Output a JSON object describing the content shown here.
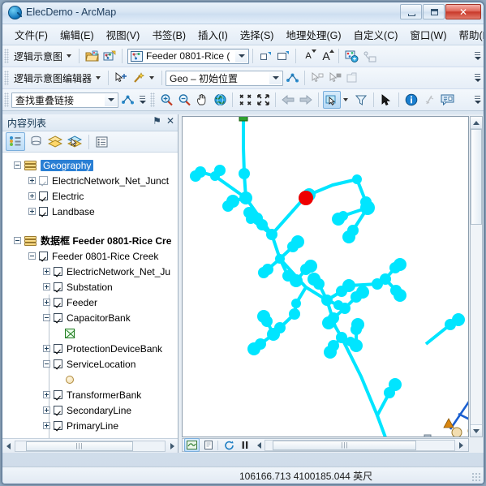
{
  "window": {
    "title": "ElecDemo - ArcMap",
    "app_icon": "arcmap-globe-icon",
    "buttons": {
      "minimize": "minimize-icon",
      "maximize": "maximize-icon",
      "close": "close-icon",
      "close_glyph": "✕"
    }
  },
  "menu": {
    "items": [
      {
        "label": "文件(F)"
      },
      {
        "label": "编辑(E)"
      },
      {
        "label": "视图(V)"
      },
      {
        "label": "书签(B)"
      },
      {
        "label": "插入(I)"
      },
      {
        "label": "选择(S)"
      },
      {
        "label": "地理处理(G)"
      },
      {
        "label": "自定义(C)"
      },
      {
        "label": "窗口(W)"
      },
      {
        "label": "帮助(H)"
      }
    ]
  },
  "toolbar_schematic": {
    "menu_label": "逻辑示意图",
    "open_diagram_icon": "open-folder-icon",
    "save_diagram_icon": "save-diagram-icon",
    "diagram_combo": {
      "value": "Feeder 0801-Rice (",
      "icon": "diagram-icon"
    },
    "buttons": [
      {
        "name": "shrink-diagram-icon"
      },
      {
        "name": "expand-diagram-icon"
      },
      {
        "name": "decrease-font-icon",
        "glyph": "A"
      },
      {
        "name": "increase-font-icon",
        "glyph": "A"
      },
      {
        "name": "diagram-properties-icon"
      },
      {
        "name": "diagram-list-icon"
      }
    ]
  },
  "toolbar_editor": {
    "menu_label": "逻辑示意图编辑器",
    "move_tool_icon": "move-node-icon",
    "layout_tool_icon": "layout-wand-icon",
    "layout_combo": {
      "value": "Geo – 初始位置"
    },
    "apply_icon": "apply-layout-icon",
    "select_node_icon": "select-node-icon",
    "select_link_icon": "select-link-icon",
    "properties_icon": "editor-properties-icon"
  },
  "toolbar_tools": {
    "task_combo": {
      "value": "查找重叠链接"
    },
    "run_icon": "run-trace-icon",
    "map_tools": [
      {
        "name": "zoom-in-icon"
      },
      {
        "name": "zoom-out-icon"
      },
      {
        "name": "pan-icon"
      },
      {
        "name": "full-extent-icon"
      },
      {
        "name": "fixed-zoom-in-icon"
      },
      {
        "name": "fixed-zoom-out-icon"
      },
      {
        "name": "previous-extent-icon"
      },
      {
        "name": "next-extent-icon"
      },
      {
        "name": "select-features-icon",
        "pressed": true
      },
      {
        "name": "select-dropdown-icon"
      },
      {
        "name": "clear-selection-icon"
      },
      {
        "name": "select-elements-icon"
      },
      {
        "name": "identify-icon"
      },
      {
        "name": "hyperlink-icon"
      },
      {
        "name": "html-popup-icon"
      }
    ]
  },
  "toc": {
    "title": "内容列表",
    "pin_icon": "pin-icon",
    "close_icon": "close-icon",
    "pin_glyph": "⚑",
    "close_glyph": "✕",
    "tabs": [
      {
        "name": "list-by-drawing-order-icon",
        "pressed": true
      },
      {
        "name": "list-by-source-icon",
        "pressed": false
      },
      {
        "name": "list-by-visibility-icon",
        "pressed": false
      },
      {
        "name": "list-by-selection-icon",
        "pressed": false
      },
      {
        "name": "toc-options-icon",
        "pressed": false
      }
    ],
    "tree": [
      {
        "id": "geography",
        "label": "Geography",
        "indent": 0,
        "expander": "minus",
        "icon": "dataframe-icon",
        "selected": true,
        "bold": false,
        "check": "none"
      },
      {
        "id": "geo-net-junction",
        "label": "ElectricNetwork_Net_Junct",
        "indent": 1,
        "expander": "plus",
        "icon": "none",
        "check": "dim"
      },
      {
        "id": "geo-electric",
        "label": "Electric",
        "indent": 1,
        "expander": "plus",
        "icon": "none",
        "check": "on"
      },
      {
        "id": "geo-landbase",
        "label": "Landbase",
        "indent": 1,
        "expander": "plus",
        "icon": "none",
        "check": "on"
      },
      {
        "id": "spacer1",
        "label": "",
        "indent": 0,
        "expander": "none",
        "icon": "none",
        "check": "none",
        "spacer": true
      },
      {
        "id": "dataframe-feeder",
        "label": "数据框 Feeder 0801-Rice Cre",
        "indent": 0,
        "expander": "minus",
        "icon": "dataframe-icon",
        "bold": true,
        "check": "none"
      },
      {
        "id": "feeder-root",
        "label": "Feeder 0801-Rice Creek",
        "indent": 1,
        "expander": "minus",
        "icon": "none",
        "check": "on"
      },
      {
        "id": "net-junction",
        "label": "ElectricNetwork_Net_Ju",
        "indent": 2,
        "expander": "plus",
        "icon": "none",
        "check": "on"
      },
      {
        "id": "substation",
        "label": "Substation",
        "indent": 2,
        "expander": "plus",
        "icon": "none",
        "check": "on"
      },
      {
        "id": "feeder",
        "label": "Feeder",
        "indent": 2,
        "expander": "plus",
        "icon": "none",
        "check": "on"
      },
      {
        "id": "capacitorbank",
        "label": "CapacitorBank",
        "indent": 2,
        "expander": "minus",
        "icon": "none",
        "check": "on"
      },
      {
        "id": "capacitorbank-symbol",
        "label": "",
        "indent": 3,
        "expander": "none",
        "icon": "symbol-capacitor",
        "check": "none",
        "symbol": true
      },
      {
        "id": "protectiondevicebank",
        "label": "ProtectionDeviceBank",
        "indent": 2,
        "expander": "plus",
        "icon": "none",
        "check": "on"
      },
      {
        "id": "servicelocation",
        "label": "ServiceLocation",
        "indent": 2,
        "expander": "minus",
        "icon": "none",
        "check": "on"
      },
      {
        "id": "servicelocation-symbol",
        "label": "",
        "indent": 3,
        "expander": "none",
        "icon": "symbol-circle",
        "check": "none",
        "symbol": true
      },
      {
        "id": "transformerbank",
        "label": "TransformerBank",
        "indent": 2,
        "expander": "plus",
        "icon": "none",
        "check": "on"
      },
      {
        "id": "secondaryline",
        "label": "SecondaryLine",
        "indent": 2,
        "expander": "plus",
        "icon": "none",
        "check": "on"
      },
      {
        "id": "primaryline",
        "label": "PrimaryLine",
        "indent": 2,
        "expander": "plus",
        "icon": "none",
        "check": "on"
      }
    ]
  },
  "map": {
    "view_buttons": [
      {
        "name": "data-view-icon",
        "pressed": true
      },
      {
        "name": "layout-view-icon",
        "pressed": false
      },
      {
        "name": "refresh-view-icon",
        "pressed": false
      },
      {
        "name": "pause-drawing-icon",
        "pressed": false
      }
    ],
    "colors": {
      "network_cyan": "#00e5ff",
      "selected_red": "#ee0000",
      "secondary_blue": "#1a5fd0",
      "service_tan": "#f2ddb0",
      "transformer_orange": "#d9860f",
      "substation_green": "#2ea02e"
    }
  },
  "status": {
    "coordinates": "106166.713  4100185.044 英尺"
  }
}
